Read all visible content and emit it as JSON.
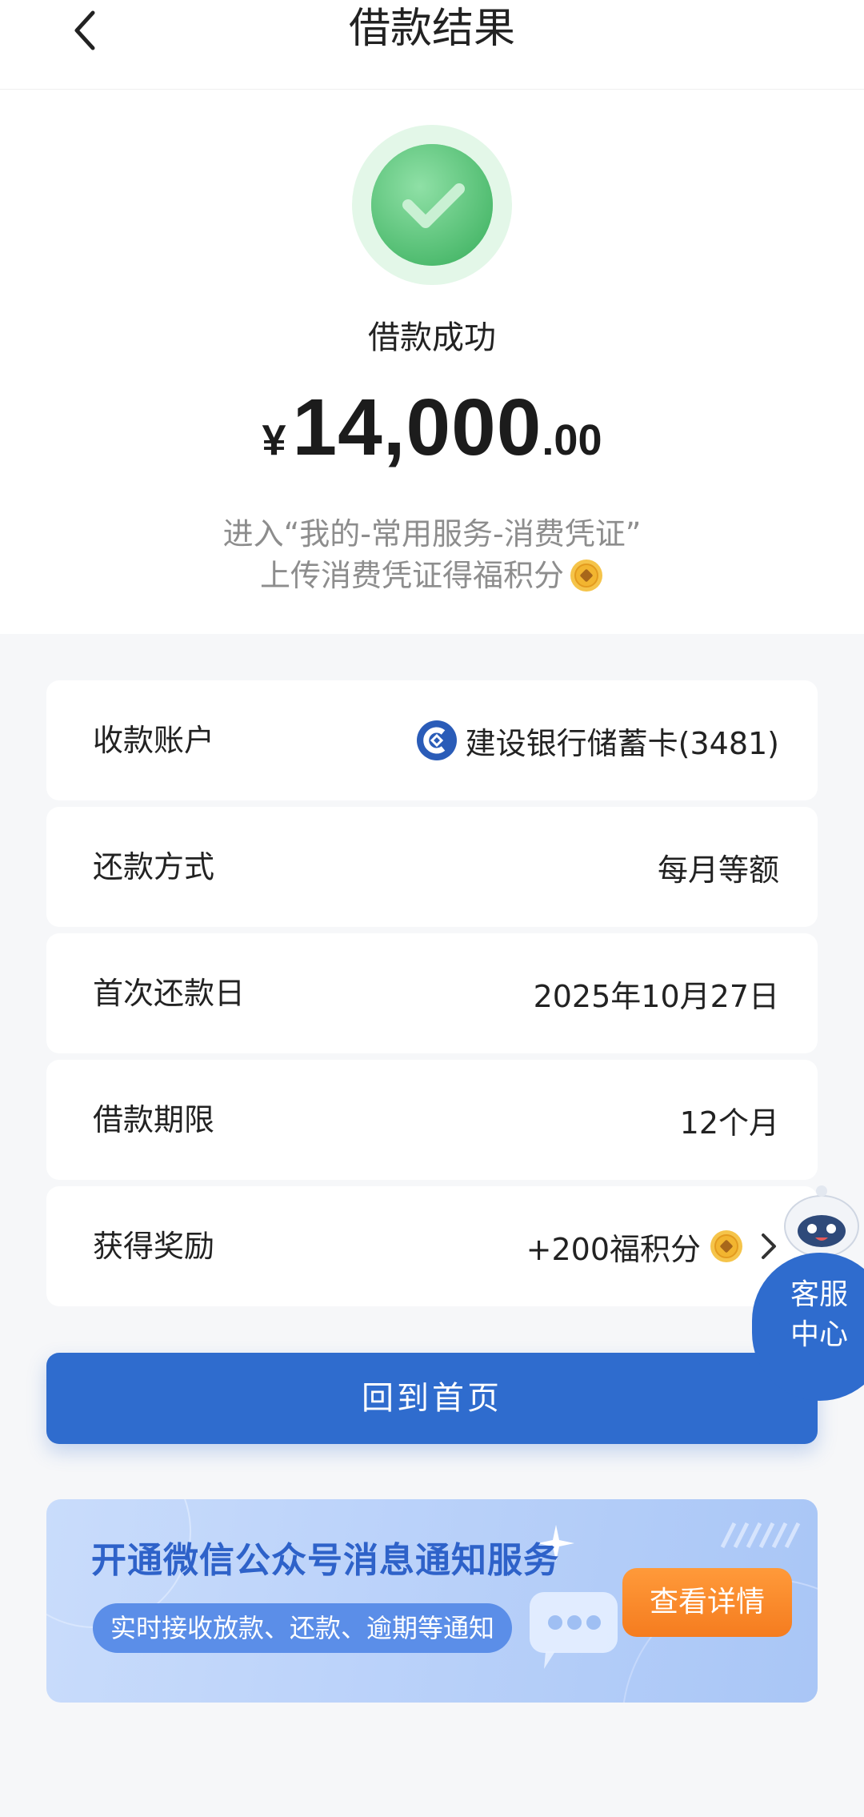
{
  "header": {
    "title": "借款结果"
  },
  "result": {
    "status": "借款成功",
    "amount_currency": "¥",
    "amount_integer": "14,000",
    "amount_decimal": ".00",
    "tip_line1": "进入“我的-常用服务-消费凭证”",
    "tip_line2": "上传消费凭证得福积分"
  },
  "details": [
    {
      "label": "收款账户",
      "value": "建设银行储蓄卡(3481)",
      "icon": "ccb-bank-icon"
    },
    {
      "label": "还款方式",
      "value": "每月等额"
    },
    {
      "label": "首次还款日",
      "value": "2025年10月27日"
    },
    {
      "label": "借款期限",
      "value": "12个月"
    },
    {
      "label": "获得奖励",
      "value": "+200福积分",
      "icon": "coin-icon"
    }
  ],
  "home_button": "回到首页",
  "banner": {
    "title": "开通微信公众号消息通知服务",
    "subtitle": "实时接收放款、还款、逾期等通知",
    "button": "查看详情"
  },
  "service": {
    "line1": "客服",
    "line2": "中心"
  },
  "colors": {
    "primary": "#2f6cce",
    "success": "#57c97a",
    "orange": "#f57c1f",
    "coin": "#f2b530"
  }
}
